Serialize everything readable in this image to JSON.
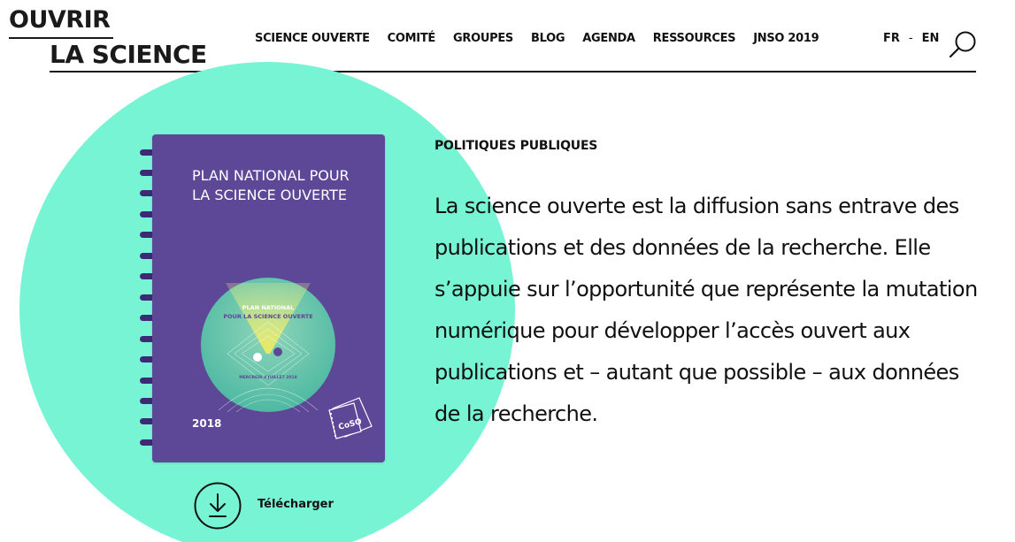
{
  "logo": {
    "line1": "OUVRIR",
    "line2": "LA SCIENCE"
  },
  "nav": {
    "items": [
      {
        "label": "SCIENCE OUVERTE"
      },
      {
        "label": "COMITÉ"
      },
      {
        "label": "GROUPES"
      },
      {
        "label": "BLOG"
      },
      {
        "label": "AGENDA"
      },
      {
        "label": "RESSOURCES"
      },
      {
        "label": "JNSO 2019"
      }
    ],
    "lang_fr": "FR",
    "lang_sep": "-",
    "lang_en": "EN",
    "search_icon": "search-icon"
  },
  "notebook": {
    "title": "PLAN NATIONAL POUR LA SCIENCE OUVERTE",
    "medallion_line1": "PLAN NATIONAL",
    "medallion_line2": "POUR LA SCIENCE OUVERTE",
    "medallion_date": "MERCREDI 4 JUILLET 2018",
    "year": "2018",
    "stamp": "CoSO"
  },
  "download": {
    "label": "Télécharger",
    "icon": "download-icon"
  },
  "content": {
    "section_label": "POLITIQUES PUBLIQUES",
    "lead": "La science ouverte est la diffusion sans entrave des publications et des données de la recherche. Elle s’appuie sur l’opportunité que représente la mutation numérique pour développer l’accès ouvert aux publications et – autant que possible – aux données de la recherche."
  },
  "colors": {
    "accent_circle": "#77f4d3",
    "notebook": "#5d4797",
    "ring": "#3c2a76",
    "text": "#111111"
  }
}
